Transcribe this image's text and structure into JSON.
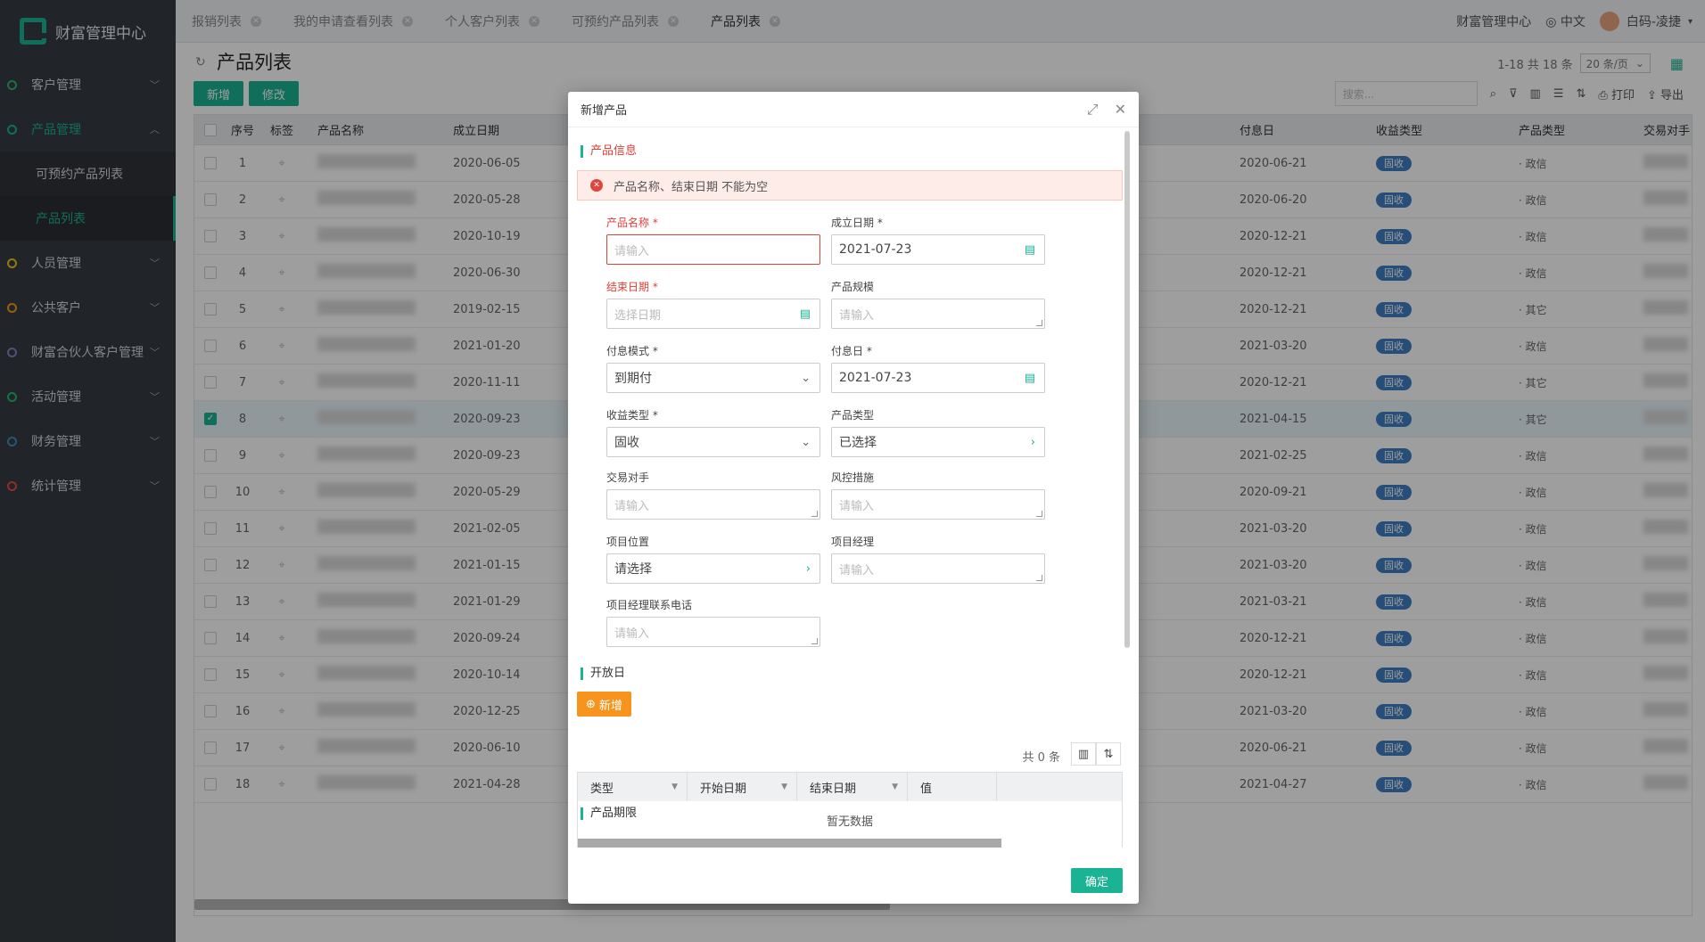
{
  "app": {
    "title": "财富管理中心"
  },
  "sidebar": {
    "items": [
      {
        "label": "客户管理",
        "color": "#2bb673",
        "expanded": false
      },
      {
        "label": "产品管理",
        "color": "#1ab394",
        "expanded": true
      },
      {
        "label": "人员管理",
        "color": "#f0c419",
        "expanded": false
      },
      {
        "label": "公共客户",
        "color": "#f39c12",
        "expanded": false
      },
      {
        "label": "财富合伙人客户管理",
        "color": "#8e7cc3",
        "expanded": false
      },
      {
        "label": "活动管理",
        "color": "#2bb673",
        "expanded": false
      },
      {
        "label": "财务管理",
        "color": "#3c8dbc",
        "expanded": false
      },
      {
        "label": "统计管理",
        "color": "#e74c3c",
        "expanded": false
      }
    ],
    "sub_items": [
      "可预约产品列表",
      "产品列表"
    ]
  },
  "tabs": [
    "报销列表",
    "我的申请查看列表",
    "个人客户列表",
    "可预约产品列表",
    "产品列表"
  ],
  "topbar": {
    "center_name": "财富管理中心",
    "language": "中文",
    "user": "白码-凌捷"
  },
  "page": {
    "title": "产品列表",
    "pager_text": "1-18 共 18 条",
    "page_size": "20 条/页",
    "add_button": "新增",
    "edit_button": "修改",
    "search_placeholder": "搜索...",
    "print": "打印",
    "export": "导出"
  },
  "table": {
    "headers": [
      "序号",
      "标签",
      "产品名称",
      "成立日期",
      "付息日",
      "收益类型",
      "产品类型",
      "交易对手"
    ],
    "rows": [
      {
        "no": "1",
        "date": "2020-06-05",
        "pay": "2020-06-21",
        "income": "固收",
        "ptype": "政信"
      },
      {
        "no": "2",
        "date": "2020-05-28",
        "pay": "2020-06-20",
        "income": "固收",
        "ptype": "政信"
      },
      {
        "no": "3",
        "date": "2020-10-19",
        "pay": "2020-12-21",
        "income": "固收",
        "ptype": "政信"
      },
      {
        "no": "4",
        "date": "2020-06-30",
        "pay": "2020-12-21",
        "income": "固收",
        "ptype": "政信"
      },
      {
        "no": "5",
        "date": "2019-02-15",
        "pay": "2020-12-21",
        "income": "固收",
        "ptype": "其它"
      },
      {
        "no": "6",
        "date": "2021-01-20",
        "pay": "2021-03-20",
        "income": "固收",
        "ptype": "政信"
      },
      {
        "no": "7",
        "date": "2020-11-11",
        "pay": "2020-12-21",
        "income": "固收",
        "ptype": "其它"
      },
      {
        "no": "8",
        "date": "2020-09-23",
        "pay": "2021-04-15",
        "income": "固收",
        "ptype": "其它",
        "selected": true
      },
      {
        "no": "9",
        "date": "2020-09-23",
        "pay": "2021-02-25",
        "income": "固收",
        "ptype": "政信"
      },
      {
        "no": "10",
        "date": "2020-05-29",
        "pay": "2020-09-21",
        "income": "固收",
        "ptype": "政信"
      },
      {
        "no": "11",
        "date": "2021-02-05",
        "pay": "2021-03-20",
        "income": "固收",
        "ptype": "政信"
      },
      {
        "no": "12",
        "date": "2021-01-15",
        "pay": "2021-03-20",
        "income": "固收",
        "ptype": "政信"
      },
      {
        "no": "13",
        "date": "2021-01-29",
        "pay": "2021-03-21",
        "income": "固收",
        "ptype": "政信"
      },
      {
        "no": "14",
        "date": "2020-09-24",
        "pay": "2020-12-21",
        "income": "固收",
        "ptype": "政信"
      },
      {
        "no": "15",
        "date": "2020-10-14",
        "pay": "2020-12-21",
        "income": "固收",
        "ptype": "政信"
      },
      {
        "no": "16",
        "date": "2020-12-25",
        "pay": "2021-03-20",
        "income": "固收",
        "ptype": "政信"
      },
      {
        "no": "17",
        "date": "2020-06-10",
        "pay": "2020-06-21",
        "income": "固收",
        "ptype": "政信"
      },
      {
        "no": "18",
        "date": "2021-04-28",
        "pay": "2021-04-27",
        "income": "固收",
        "ptype": "政信"
      }
    ]
  },
  "modal": {
    "title": "新增产品",
    "section_info": "产品信息",
    "error": "产品名称、结束日期 不能为空",
    "fields": {
      "product_name": {
        "label": "产品名称 *",
        "placeholder": "请输入"
      },
      "found_date": {
        "label": "成立日期 *",
        "value": "2021-07-23"
      },
      "end_date": {
        "label": "结束日期 *",
        "placeholder": "选择日期"
      },
      "scale": {
        "label": "产品规模",
        "placeholder": "请输入"
      },
      "pay_mode": {
        "label": "付息模式 *",
        "value": "到期付"
      },
      "pay_date": {
        "label": "付息日 *",
        "value": "2021-07-23"
      },
      "income_type": {
        "label": "收益类型 *",
        "value": "固收"
      },
      "product_type": {
        "label": "产品类型",
        "value": "已选择"
      },
      "counterparty": {
        "label": "交易对手",
        "placeholder": "请输入"
      },
      "risk": {
        "label": "风控措施",
        "placeholder": "请输入"
      },
      "location": {
        "label": "项目位置",
        "value": "请选择"
      },
      "manager": {
        "label": "项目经理",
        "placeholder": "请输入"
      },
      "manager_phone": {
        "label": "项目经理联系电话",
        "placeholder": "请输入"
      }
    },
    "section_open": "开放日",
    "add_button": "新增",
    "count_text": "共 0 条",
    "sub_headers": [
      "类型",
      "开始日期",
      "结束日期",
      "值"
    ],
    "empty_text": "暂无数据",
    "section_term": "产品期限",
    "confirm": "确定"
  }
}
